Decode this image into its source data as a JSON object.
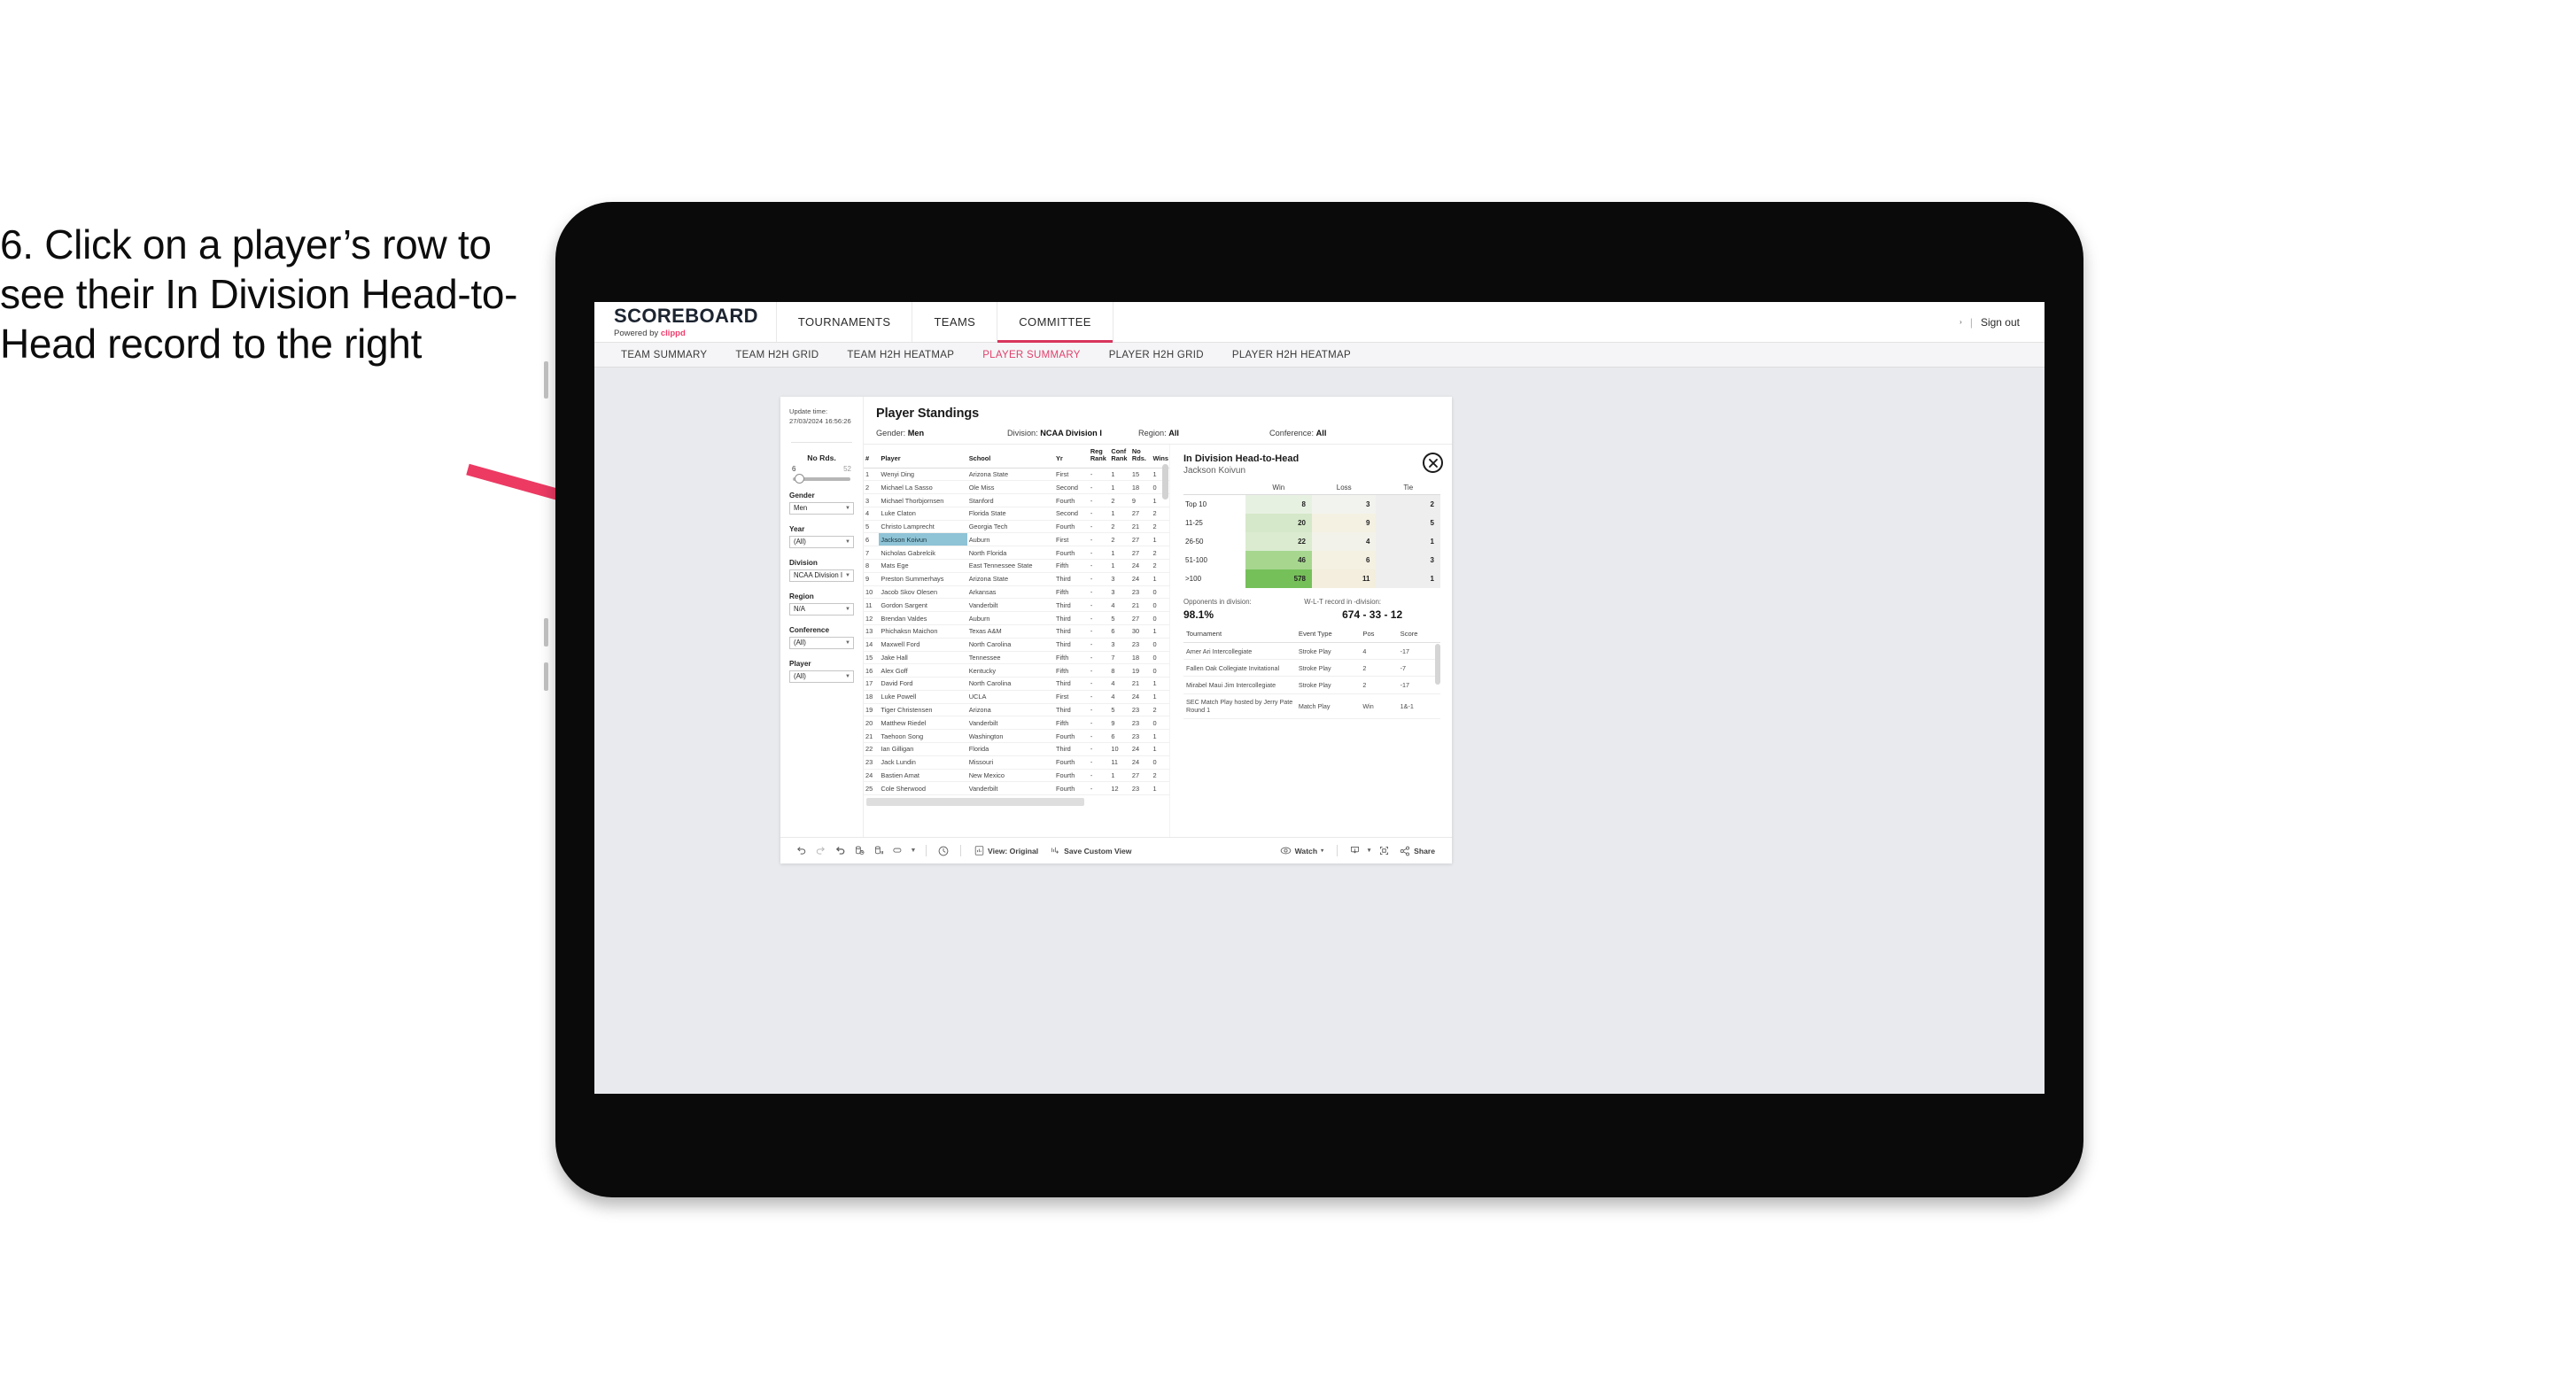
{
  "annotation": {
    "text": "6. Click on a player’s row to see their In Division Head-to-Head record to the right",
    "arrow_color": "#ec3a63"
  },
  "topnav": {
    "brand_title": "SCOREBOARD",
    "brand_sub_prefix": "Powered by ",
    "brand_sub_highlight": "clippd",
    "items": [
      {
        "label": "TOURNAMENTS",
        "active": false
      },
      {
        "label": "TEAMS",
        "active": false
      },
      {
        "label": "COMMITTEE",
        "active": true
      }
    ],
    "sign_out": "Sign out",
    "separator": "|",
    "caret": "›",
    "accent": "#d7355c"
  },
  "subnav": {
    "items": [
      {
        "label": "TEAM SUMMARY",
        "active": false
      },
      {
        "label": "TEAM H2H GRID",
        "active": false
      },
      {
        "label": "TEAM H2H HEATMAP",
        "active": false
      },
      {
        "label": "PLAYER SUMMARY",
        "active": true
      },
      {
        "label": "PLAYER H2H GRID",
        "active": false
      },
      {
        "label": "PLAYER H2H HEATMAP",
        "active": false
      }
    ],
    "active_color": "#e0416c"
  },
  "rail": {
    "update_label": "Update time:",
    "update_value": "27/03/2024 16:56:26",
    "slider": {
      "title": "No Rds.",
      "min": "6",
      "max": "52"
    },
    "filters": [
      {
        "label": "Gender",
        "value": "Men"
      },
      {
        "label": "Year",
        "value": "(All)"
      },
      {
        "label": "Division",
        "value": "NCAA Division I"
      },
      {
        "label": "Region",
        "value": "N/A"
      },
      {
        "label": "Conference",
        "value": "(All)"
      },
      {
        "label": "Player",
        "value": "(All)"
      }
    ]
  },
  "main": {
    "title": "Player Standings",
    "crumbs": [
      {
        "label": "Gender:",
        "value": "Men"
      },
      {
        "label": "Division:",
        "value": "NCAA Division I"
      },
      {
        "label": "Region:",
        "value": "All"
      },
      {
        "label": "Conference:",
        "value": "All"
      }
    ]
  },
  "standings": {
    "columns": [
      "#",
      "Player",
      "School",
      "Yr",
      "Reg Rank",
      "Conf Rank",
      "No Rds.",
      "Wins"
    ],
    "selected_row_index": 5,
    "rows": [
      {
        "n": "1",
        "player": "Wenyi Ding",
        "school": "Arizona State",
        "yr": "First",
        "reg": "-",
        "conf": "1",
        "rds": "15",
        "wins": "1"
      },
      {
        "n": "2",
        "player": "Michael La Sasso",
        "school": "Ole Miss",
        "yr": "Second",
        "reg": "-",
        "conf": "1",
        "rds": "18",
        "wins": "0"
      },
      {
        "n": "3",
        "player": "Michael Thorbjornsen",
        "school": "Stanford",
        "yr": "Fourth",
        "reg": "-",
        "conf": "2",
        "rds": "9",
        "wins": "1"
      },
      {
        "n": "4",
        "player": "Luke Claton",
        "school": "Florida State",
        "yr": "Second",
        "reg": "-",
        "conf": "1",
        "rds": "27",
        "wins": "2"
      },
      {
        "n": "5",
        "player": "Christo Lamprecht",
        "school": "Georgia Tech",
        "yr": "Fourth",
        "reg": "-",
        "conf": "2",
        "rds": "21",
        "wins": "2"
      },
      {
        "n": "6",
        "player": "Jackson Koivun",
        "school": "Auburn",
        "yr": "First",
        "reg": "-",
        "conf": "2",
        "rds": "27",
        "wins": "1"
      },
      {
        "n": "7",
        "player": "Nicholas Gabrelcik",
        "school": "North Florida",
        "yr": "Fourth",
        "reg": "-",
        "conf": "1",
        "rds": "27",
        "wins": "2"
      },
      {
        "n": "8",
        "player": "Mats Ege",
        "school": "East Tennessee State",
        "yr": "Fifth",
        "reg": "-",
        "conf": "1",
        "rds": "24",
        "wins": "2"
      },
      {
        "n": "9",
        "player": "Preston Summerhays",
        "school": "Arizona State",
        "yr": "Third",
        "reg": "-",
        "conf": "3",
        "rds": "24",
        "wins": "1"
      },
      {
        "n": "10",
        "player": "Jacob Skov Olesen",
        "school": "Arkansas",
        "yr": "Fifth",
        "reg": "-",
        "conf": "3",
        "rds": "23",
        "wins": "0"
      },
      {
        "n": "11",
        "player": "Gordon Sargent",
        "school": "Vanderbilt",
        "yr": "Third",
        "reg": "-",
        "conf": "4",
        "rds": "21",
        "wins": "0"
      },
      {
        "n": "12",
        "player": "Brendan Valdes",
        "school": "Auburn",
        "yr": "Third",
        "reg": "-",
        "conf": "5",
        "rds": "27",
        "wins": "0"
      },
      {
        "n": "13",
        "player": "Phichaksn Maichon",
        "school": "Texas A&M",
        "yr": "Third",
        "reg": "-",
        "conf": "6",
        "rds": "30",
        "wins": "1"
      },
      {
        "n": "14",
        "player": "Maxwell Ford",
        "school": "North Carolina",
        "yr": "Third",
        "reg": "-",
        "conf": "3",
        "rds": "23",
        "wins": "0"
      },
      {
        "n": "15",
        "player": "Jake Hall",
        "school": "Tennessee",
        "yr": "Fifth",
        "reg": "-",
        "conf": "7",
        "rds": "18",
        "wins": "0"
      },
      {
        "n": "16",
        "player": "Alex Goff",
        "school": "Kentucky",
        "yr": "Fifth",
        "reg": "-",
        "conf": "8",
        "rds": "19",
        "wins": "0"
      },
      {
        "n": "17",
        "player": "David Ford",
        "school": "North Carolina",
        "yr": "Third",
        "reg": "-",
        "conf": "4",
        "rds": "21",
        "wins": "1"
      },
      {
        "n": "18",
        "player": "Luke Powell",
        "school": "UCLA",
        "yr": "First",
        "reg": "-",
        "conf": "4",
        "rds": "24",
        "wins": "1"
      },
      {
        "n": "19",
        "player": "Tiger Christensen",
        "school": "Arizona",
        "yr": "Third",
        "reg": "-",
        "conf": "5",
        "rds": "23",
        "wins": "2"
      },
      {
        "n": "20",
        "player": "Matthew Riedel",
        "school": "Vanderbilt",
        "yr": "Fifth",
        "reg": "-",
        "conf": "9",
        "rds": "23",
        "wins": "0"
      },
      {
        "n": "21",
        "player": "Taehoon Song",
        "school": "Washington",
        "yr": "Fourth",
        "reg": "-",
        "conf": "6",
        "rds": "23",
        "wins": "1"
      },
      {
        "n": "22",
        "player": "Ian Gilligan",
        "school": "Florida",
        "yr": "Third",
        "reg": "-",
        "conf": "10",
        "rds": "24",
        "wins": "1"
      },
      {
        "n": "23",
        "player": "Jack Lundin",
        "school": "Missouri",
        "yr": "Fourth",
        "reg": "-",
        "conf": "11",
        "rds": "24",
        "wins": "0"
      },
      {
        "n": "24",
        "player": "Bastien Amat",
        "school": "New Mexico",
        "yr": "Fourth",
        "reg": "-",
        "conf": "1",
        "rds": "27",
        "wins": "2"
      },
      {
        "n": "25",
        "player": "Cole Sherwood",
        "school": "Vanderbilt",
        "yr": "Fourth",
        "reg": "-",
        "conf": "12",
        "rds": "23",
        "wins": "1"
      }
    ]
  },
  "h2h": {
    "title": "In Division Head-to-Head",
    "player": "Jackson Koivun",
    "close_icon": "close-circle-icon",
    "columns": [
      "",
      "Win",
      "Loss",
      "Tie"
    ],
    "rows": [
      {
        "band": "Top 10",
        "win": "8",
        "loss": "3",
        "tie": "2",
        "win_color": "#e7f1e2",
        "loss_color": "#f2f2ee",
        "tie_color": "#eeeeee"
      },
      {
        "band": "11-25",
        "win": "20",
        "loss": "9",
        "tie": "5",
        "win_color": "#d5e8c9",
        "loss_color": "#f4f1e3",
        "tie_color": "#eeeeee"
      },
      {
        "band": "26-50",
        "win": "22",
        "loss": "4",
        "tie": "1",
        "win_color": "#daebcf",
        "loss_color": "#f3f2ea",
        "tie_color": "#eeeeee"
      },
      {
        "band": "51-100",
        "win": "46",
        "loss": "6",
        "tie": "3",
        "win_color": "#a7d78f",
        "loss_color": "#f4f0e2",
        "tie_color": "#eeeeee"
      },
      {
        "band": ">100",
        "win": "578",
        "loss": "11",
        "tie": "1",
        "win_color": "#76c martial",
        "loss_color": "#f3eedd",
        "tie_color": "#eeeeee"
      }
    ],
    "stats": [
      {
        "label": "Opponents in division:",
        "value": "98.1%"
      },
      {
        "label": "W-L-T record in -division:",
        "value": "674 - 33 - 12"
      }
    ],
    "tournament_columns": [
      "Tournament",
      "Event Type",
      "Pos",
      "Score"
    ],
    "tournaments": [
      {
        "name": "Amer Ari Intercollegiate",
        "type": "Stroke Play",
        "pos": "4",
        "score": "-17"
      },
      {
        "name": "Fallen Oak Collegiate Invitational",
        "type": "Stroke Play",
        "pos": "2",
        "score": "-7"
      },
      {
        "name": "Mirabel Maui Jim Intercollegiate",
        "type": "Stroke Play",
        "pos": "2",
        "score": "-17"
      },
      {
        "name": "SEC Match Play hosted by Jerry Pate Round 1",
        "type": "Match Play",
        "pos": "Win",
        "score": "1&-1"
      }
    ]
  },
  "toolbar": {
    "view_label": "View: Original",
    "save_label": "Save Custom View",
    "watch_label": "Watch",
    "share_label": "Share",
    "caret": "▾"
  }
}
